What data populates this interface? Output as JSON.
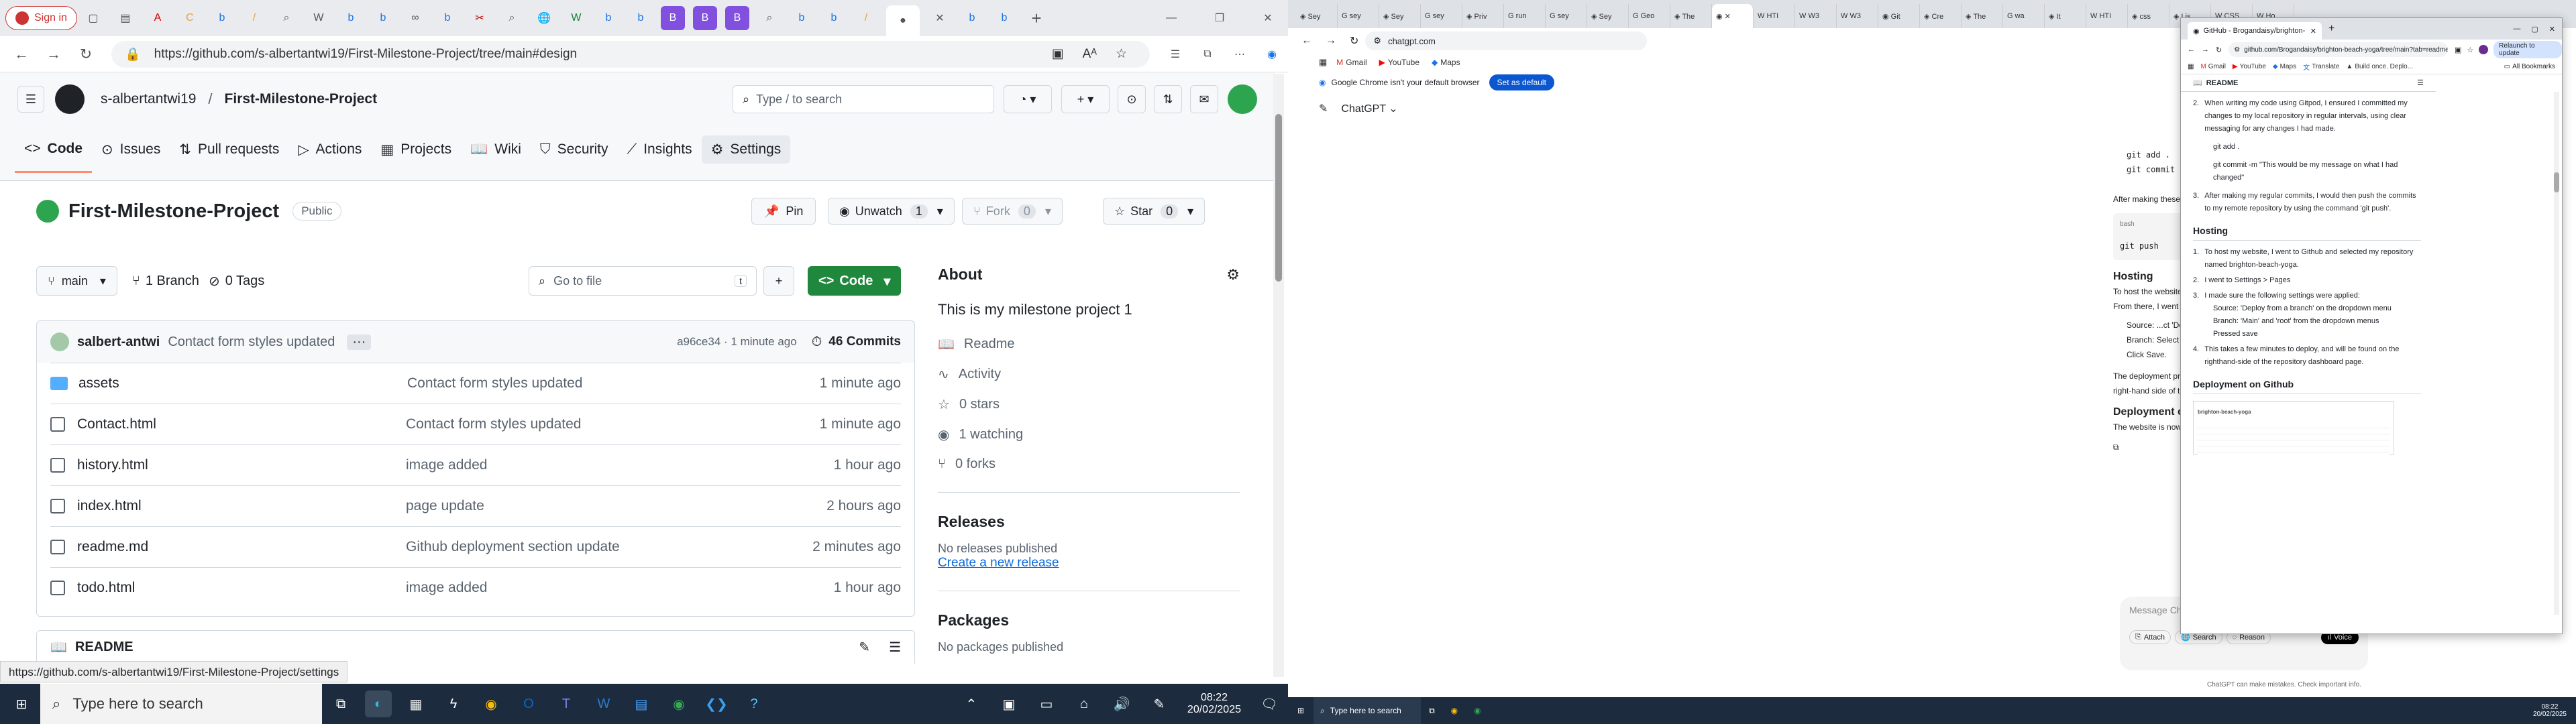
{
  "left": {
    "tabs": {
      "signin": "Sign in",
      "close": "✕",
      "new_tab": "+",
      "minimize": "—",
      "maximize": "❐",
      "close_window": "✕"
    },
    "address": {
      "url": "https://github.com/s-albertantwi19/First-Milestone-Project/tree/main#design"
    },
    "github": {
      "owner": "s-albertantwi19",
      "repo": "First-Milestone-Project",
      "search_placeholder": "Type / to search",
      "nav": [
        "Code",
        "Issues",
        "Pull requests",
        "Actions",
        "Projects",
        "Wiki",
        "Security",
        "Insights",
        "Settings"
      ],
      "repo_title": "First-Milestone-Project",
      "visibility": "Public",
      "pin": "Pin",
      "unwatch": "Unwatch",
      "unwatch_count": "1",
      "fork": "Fork",
      "fork_count": "0",
      "star": "Star",
      "star_count": "0",
      "branch": "main",
      "branches": "1 Branch",
      "tags": "0 Tags",
      "go_to_file": "Go to file",
      "go_key": "t",
      "code_btn": "Code",
      "commit_user": "salbert-antwi",
      "commit_msg": "Contact form styles updated",
      "commit_hash": "a96ce34 · 1 minute ago",
      "commits": "46 Commits",
      "files": [
        {
          "name": "assets",
          "type": "folder",
          "msg": "Contact form styles updated",
          "time": "1 minute ago"
        },
        {
          "name": "Contact.html",
          "type": "file",
          "msg": "Contact form styles updated",
          "time": "1 minute ago"
        },
        {
          "name": "history.html",
          "type": "file",
          "msg": "image added",
          "time": "1 hour ago"
        },
        {
          "name": "index.html",
          "type": "file",
          "msg": "page update",
          "time": "2 hours ago"
        },
        {
          "name": "readme.md",
          "type": "file",
          "msg": "Github deployment section update",
          "time": "2 minutes ago"
        },
        {
          "name": "todo.html",
          "type": "file",
          "msg": "image added",
          "time": "1 hour ago"
        }
      ],
      "readme_label": "README",
      "about": {
        "title": "About",
        "desc": "This is my milestone project 1",
        "readme": "Readme",
        "activity": "Activity",
        "stars": "0 stars",
        "watching": "1 watching",
        "forks": "0 forks"
      },
      "releases": {
        "title": "Releases",
        "none": "No releases published",
        "create": "Create a new release"
      },
      "packages": {
        "title": "Packages",
        "none": "No packages published"
      }
    },
    "status_url": "https://github.com/s-albertantwi19/First-Milestone-Project/settings",
    "taskbar": {
      "search": "Type here to search",
      "time": "08:22",
      "date": "20/02/2025"
    }
  },
  "right": {
    "url": "chatgpt.com",
    "bookmarks": [
      "Gmail",
      "YouTube",
      "Maps"
    ],
    "default_banner": "Google Chrome isn't your default browser",
    "set_default": "Set as default",
    "chatgpt_title": "ChatGPT",
    "chat_snippets": {
      "git_add": "git add .",
      "git_commit": "git commit -m \"Desc",
      "after": "After making these com",
      "bash": "bash",
      "push": "git push",
      "hosting": "Hosting",
      "host1": "To host the website, I n",
      "host2": "From there, I went to S",
      "src": "Source: ...ct 'De",
      "branch": "Branch: Select 'Ma",
      "click": "Click Save.",
      "deploy": "The deployment proce",
      "deploy2": "right-hand side of the",
      "deploy_on": "Deployment on G",
      "live": "The website is now suc"
    },
    "msg_placeholder": "Message ChatGPT",
    "attach": "Attach",
    "search": "Search",
    "reason": "Reason",
    "voice": "Voice",
    "footer": "ChatGPT can make mistakes. Check important info.",
    "popup": {
      "tab": "GitHub - Brogandaisy/brighton-",
      "url": "github.com/Brogandaisy/brighton-beach-yoga/tree/main?tab=readme-ov-file",
      "relaunch": "Relaunch to update",
      "bookmarks": [
        "Gmail",
        "YouTube",
        "Maps",
        "Translate",
        "Build once. Deplo..."
      ],
      "all_bookmarks": "All Bookmarks",
      "readme": "README",
      "li2": "When writing my code using Gitpod, I ensured I committed my changes to my local repository in regular intervals, using clear messaging for any changes I had made.",
      "git_add": "git add .",
      "git_commit": "git commit -m \"This would be my message on what I had changed\"",
      "li3": "After making my regular commits, I would then push the commits to my remote repository by using the command 'git push'.",
      "hosting": "Hosting",
      "h1": "To host my website, I went to Github and selected my repository named brighton-beach-yoga.",
      "h2": "I went to Settings > Pages",
      "h3": "I made sure the following settings were applied:",
      "s1": "Source: 'Deploy from a branch' on the dropdown menu",
      "s2": "Branch: 'Main' and 'root' from the dropdown menus",
      "s3": "Pressed save",
      "h4": "This takes a few minutes to deploy, and will be found on the righthand-side of the repository dashboard page.",
      "deploy": "Deployment on Github",
      "shot_repo": "brighton-beach-yoga"
    },
    "taskbar": {
      "search": "Type here to search",
      "time": "08:22",
      "date": "20/02/2025"
    }
  }
}
